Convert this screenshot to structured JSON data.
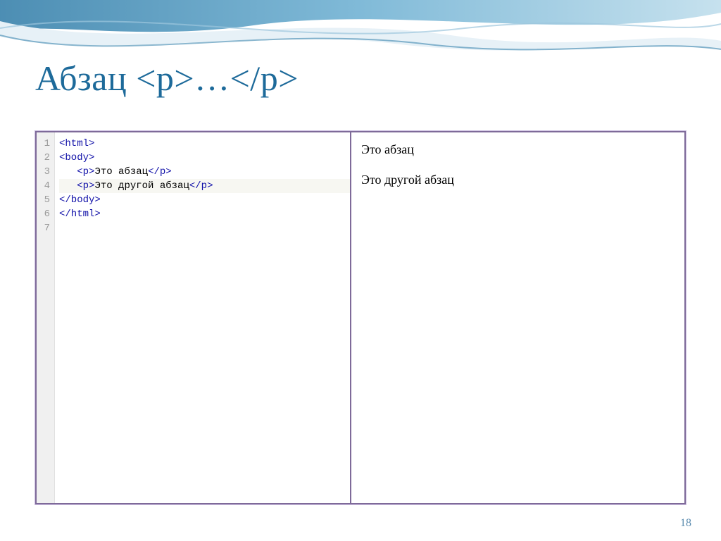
{
  "title": "Абзац  <p>…</p>",
  "page_number": "18",
  "code": {
    "lines": [
      {
        "n": "1",
        "indent": "",
        "open": "<html>",
        "text": "",
        "close": ""
      },
      {
        "n": "2",
        "indent": "",
        "open": "<body>",
        "text": "",
        "close": ""
      },
      {
        "n": "3",
        "indent": "   ",
        "open": "<p>",
        "text": "Это абзац",
        "close": "</p>"
      },
      {
        "n": "4",
        "indent": "   ",
        "open": "<p>",
        "text": "Это другой абзац",
        "close": "</p>",
        "hl": true
      },
      {
        "n": "5",
        "indent": "",
        "open": "</body>",
        "text": "",
        "close": ""
      },
      {
        "n": "6",
        "indent": "",
        "open": "</html>",
        "text": "",
        "close": ""
      },
      {
        "n": "7",
        "indent": "",
        "open": "",
        "text": "",
        "close": ""
      }
    ]
  },
  "preview": {
    "p1": "Это абзац",
    "p2": "Это другой абзац"
  }
}
